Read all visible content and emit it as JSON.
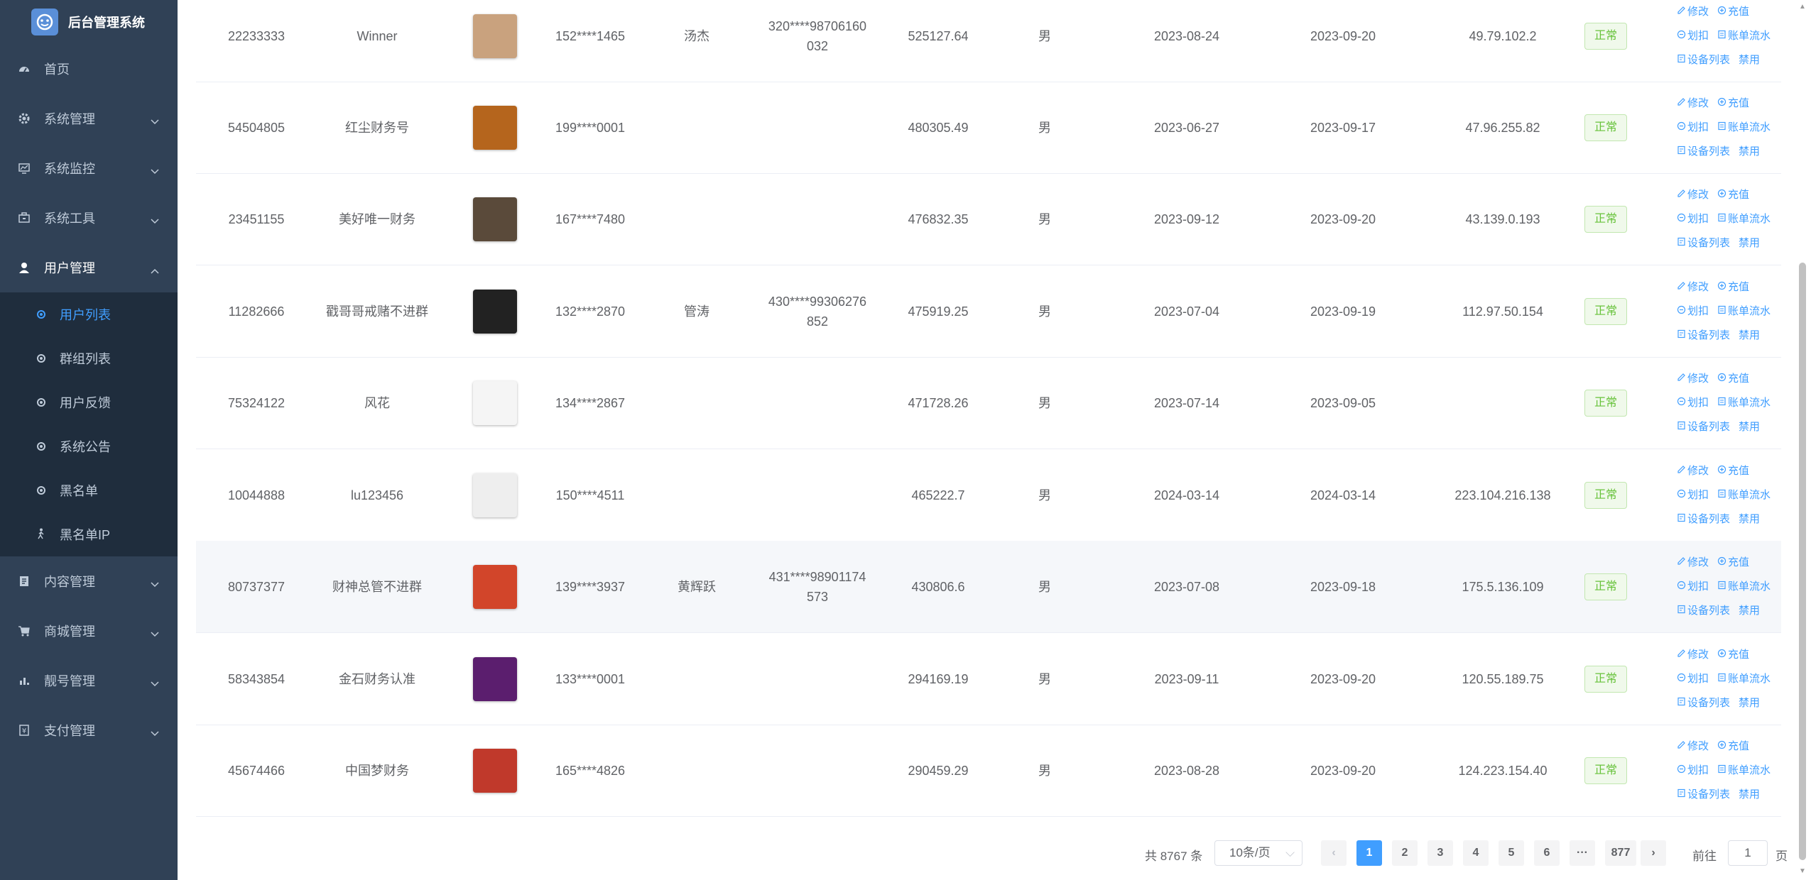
{
  "app": {
    "title": "后台管理系统"
  },
  "sidebar": {
    "items": [
      {
        "label": "首页",
        "icon": "dashboard-icon"
      },
      {
        "label": "系统管理",
        "icon": "gear-icon"
      },
      {
        "label": "系统监控",
        "icon": "monitor-icon"
      },
      {
        "label": "系统工具",
        "icon": "toolbox-icon"
      },
      {
        "label": "用户管理",
        "icon": "user-icon"
      },
      {
        "label": "内容管理",
        "icon": "document-icon"
      },
      {
        "label": "商城管理",
        "icon": "cart-icon"
      },
      {
        "label": "靓号管理",
        "icon": "chart-icon"
      },
      {
        "label": "支付管理",
        "icon": "payment-icon"
      }
    ],
    "user_submenu": [
      {
        "label": "用户列表"
      },
      {
        "label": "群组列表"
      },
      {
        "label": "用户反馈"
      },
      {
        "label": "系统公告"
      },
      {
        "label": "黑名单"
      },
      {
        "label": "黑名单IP"
      }
    ]
  },
  "ops": {
    "edit": "修改",
    "recharge": "充值",
    "deduct": "划扣",
    "flow": "账单流水",
    "devices": "设备列表",
    "ban": "禁用"
  },
  "rows": [
    {
      "id": "22233333",
      "name": "Winner",
      "phone": "152****1465",
      "real": "汤杰",
      "idcard": "320****98706160032",
      "balance": "525127.64",
      "sex": "男",
      "reg": "2023-08-24",
      "login": "2023-09-20",
      "ip": "49.79.102.2",
      "status": "正常",
      "avatar_color": "#c9a27e"
    },
    {
      "id": "54504805",
      "name": "红尘财务号",
      "phone": "199****0001",
      "real": "",
      "idcard": "",
      "balance": "480305.49",
      "sex": "男",
      "reg": "2023-06-27",
      "login": "2023-09-17",
      "ip": "47.96.255.82",
      "status": "正常",
      "avatar_color": "#b5651d"
    },
    {
      "id": "23451155",
      "name": "美好唯一财务",
      "phone": "167****7480",
      "real": "",
      "idcard": "",
      "balance": "476832.35",
      "sex": "男",
      "reg": "2023-09-12",
      "login": "2023-09-20",
      "ip": "43.139.0.193",
      "status": "正常",
      "avatar_color": "#5a4a3a"
    },
    {
      "id": "11282666",
      "name": "戳哥哥戒赌不进群",
      "phone": "132****2870",
      "real": "管涛",
      "idcard": "430****99306276852",
      "balance": "475919.25",
      "sex": "男",
      "reg": "2023-07-04",
      "login": "2023-09-19",
      "ip": "112.97.50.154",
      "status": "正常",
      "avatar_color": "#222222"
    },
    {
      "id": "75324122",
      "name": "风花",
      "phone": "134****2867",
      "real": "",
      "idcard": "",
      "balance": "471728.26",
      "sex": "男",
      "reg": "2023-07-14",
      "login": "2023-09-05",
      "ip": "",
      "status": "正常",
      "avatar_color": "#f5f5f5"
    },
    {
      "id": "10044888",
      "name": "lu123456",
      "phone": "150****4511",
      "real": "",
      "idcard": "",
      "balance": "465222.7",
      "sex": "男",
      "reg": "2024-03-14",
      "login": "2024-03-14",
      "ip": "223.104.216.138",
      "status": "正常",
      "avatar_color": "#eeeeee"
    },
    {
      "id": "80737377",
      "name": "财神总管不进群",
      "phone": "139****3937",
      "real": "黄辉跃",
      "idcard": "431****98901174573",
      "balance": "430806.6",
      "sex": "男",
      "reg": "2023-07-08",
      "login": "2023-09-18",
      "ip": "175.5.136.109",
      "status": "正常",
      "avatar_color": "#d2452a"
    },
    {
      "id": "58343854",
      "name": "金石财务认准",
      "phone": "133****0001",
      "real": "",
      "idcard": "",
      "balance": "294169.19",
      "sex": "男",
      "reg": "2023-09-11",
      "login": "2023-09-20",
      "ip": "120.55.189.75",
      "status": "正常",
      "avatar_color": "#5b1e6e"
    },
    {
      "id": "45674466",
      "name": "中国梦财务",
      "phone": "165****4826",
      "real": "",
      "idcard": "",
      "balance": "290459.29",
      "sex": "男",
      "reg": "2023-08-28",
      "login": "2023-09-20",
      "ip": "124.223.154.40",
      "status": "正常",
      "avatar_color": "#c0392b"
    }
  ],
  "pager": {
    "total": "共 8767 条",
    "size": "10条/页",
    "pages": [
      "1",
      "2",
      "3",
      "4",
      "5",
      "6",
      "···",
      "877"
    ],
    "goto": "前往",
    "goto_value": "1",
    "unit": "页",
    "prev": "‹",
    "next": "›"
  },
  "colors": {
    "sidebar_bg": "#304156",
    "submenu_bg": "#1f2d3d",
    "accent": "#409eff",
    "success": "#67c23a"
  }
}
